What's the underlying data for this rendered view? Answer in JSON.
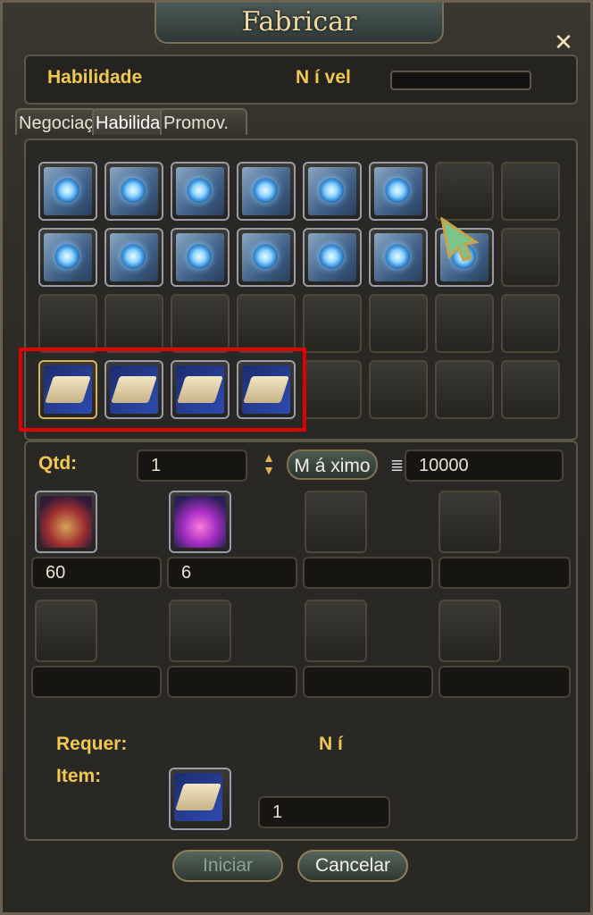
{
  "window": {
    "title": "Fabricar"
  },
  "header": {
    "skill_label": "Habilidade",
    "level_label": "N í vel"
  },
  "tabs": [
    {
      "label": "Negociação"
    },
    {
      "label": "Habilidade"
    },
    {
      "label": "Promov."
    }
  ],
  "grid": {
    "row1": [
      "blue-spiral-tome",
      "blue-spiral-tome",
      "blue-spiral-tome",
      "blue-spiral-tome",
      "blue-spiral-tome",
      "blue-spiral-tome",
      "empty",
      "empty"
    ],
    "row2": [
      "blue-spiral-tome",
      "blue-spiral-tome",
      "blue-spiral-tome",
      "blue-spiral-tome",
      "blue-spiral-tome",
      "blue-spiral-tome",
      "blue-spiral-tome",
      "empty"
    ],
    "row3": [
      "empty",
      "empty",
      "empty",
      "empty",
      "empty",
      "empty",
      "empty",
      "empty"
    ],
    "row4": [
      "recipe-scroll",
      "recipe-scroll",
      "recipe-scroll",
      "recipe-scroll",
      "empty",
      "empty",
      "empty",
      "empty"
    ],
    "highlight_color": "#e00000"
  },
  "materials": {
    "qty_label": "Qtd:",
    "qty_value": "1",
    "max_label": "M á ximo",
    "cost_value": "10000",
    "slot1_amount": "60",
    "slot2_amount": "6"
  },
  "requirements": {
    "req_label": "Requer:",
    "req_level": "N í",
    "item_label": "Item:",
    "item_amount": "1"
  },
  "buttons": {
    "start": "Iniciar",
    "cancel": "Cancelar"
  },
  "colors": {
    "gold_text": "#f0c850",
    "panel_border": "#5d5545"
  }
}
